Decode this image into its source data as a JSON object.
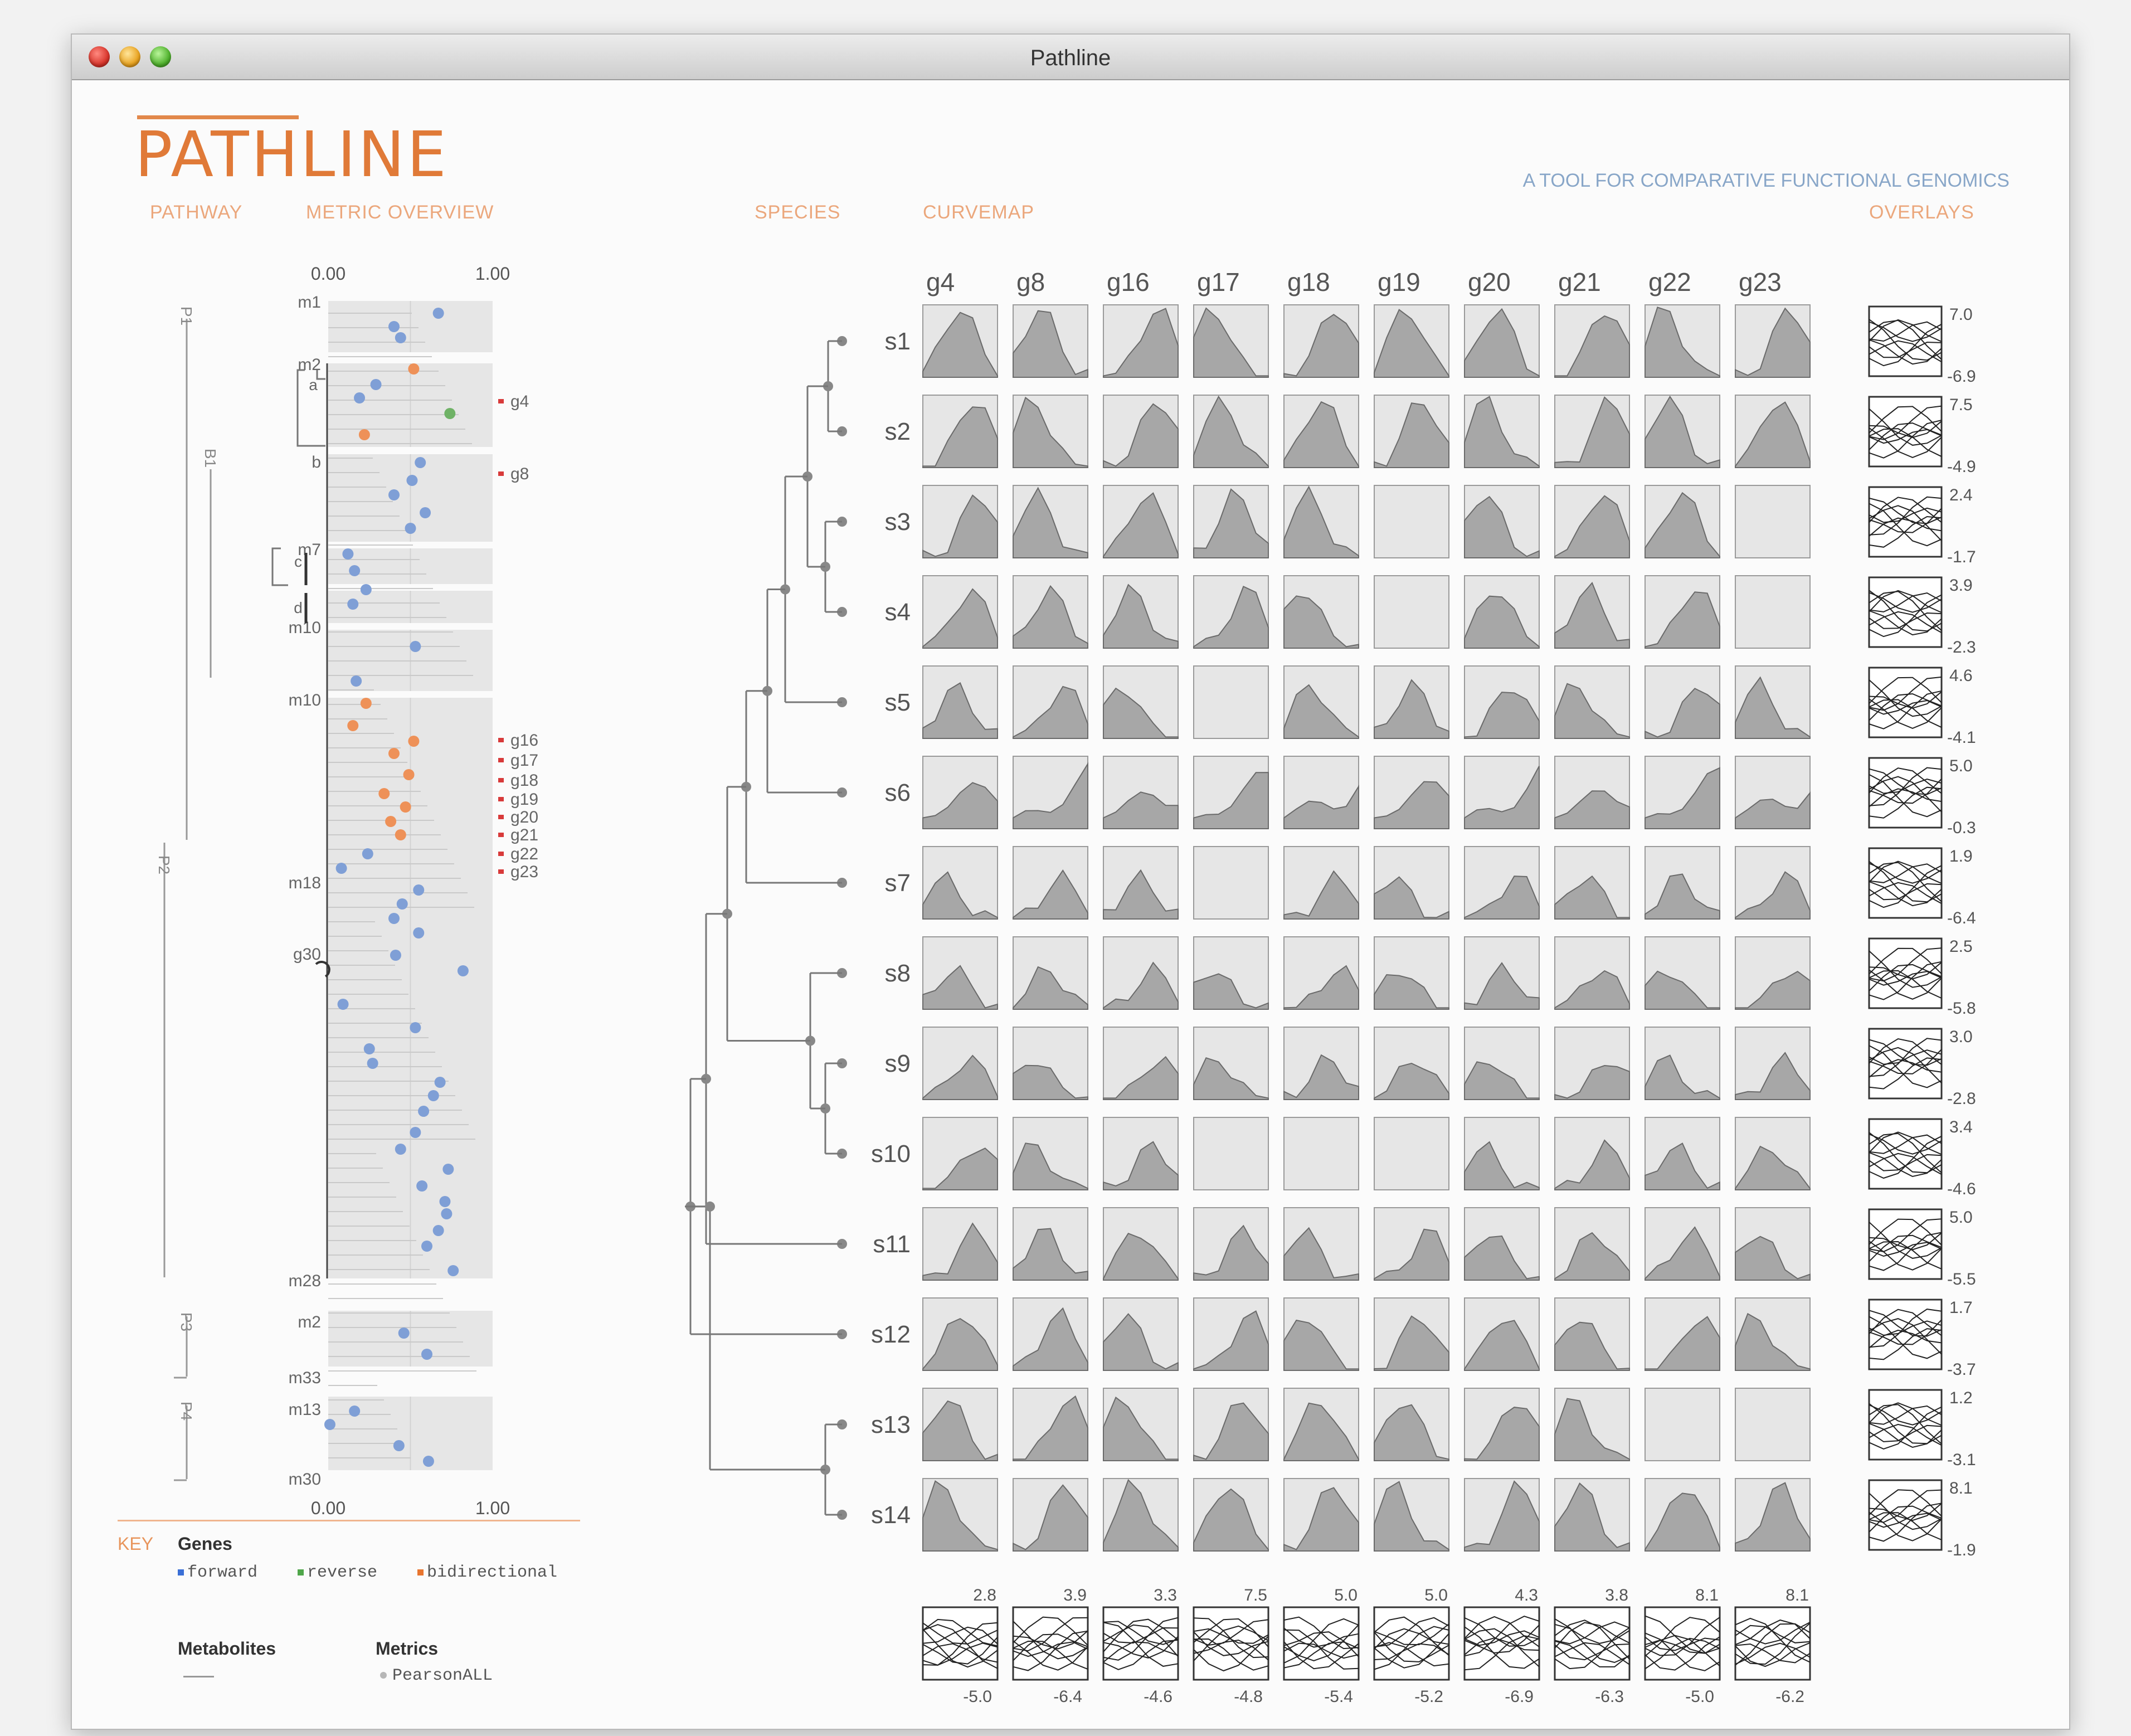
{
  "window": {
    "title": "Pathline"
  },
  "app": {
    "name": "PATHLINE",
    "tagline": "A TOOL FOR COMPARATIVE FUNCTIONAL GENOMICS"
  },
  "sections": {
    "pathway": "PATHWAY",
    "metric": "METRIC OVERVIEW",
    "species": "SPECIES",
    "curvemap": "CURVEMAP",
    "overlays": "OVERLAYS"
  },
  "colors": {
    "accent": "#e07a38",
    "forward": "#7f9fd6",
    "reverse": "#6fb266",
    "bidirectional": "#ee9158",
    "curve_fill": "#a7a7a7",
    "cell_bg": "#e6e6e6"
  },
  "metric": {
    "axis_top": [
      "0.00",
      "1.00"
    ],
    "axis_bottom": [
      "0.00",
      "1.00"
    ],
    "pathways": [
      {
        "id": "P1",
        "sub": "B1"
      },
      {
        "id": "P2"
      },
      {
        "id": "P3"
      },
      {
        "id": "P4"
      }
    ],
    "metabolite_labels": [
      "m1",
      "m2",
      "b",
      "m7",
      "m10",
      "m10",
      "m18",
      "g30",
      "m28",
      "m2",
      "m33",
      "m13",
      "m30"
    ],
    "small_labels": [
      "a",
      "c",
      "d"
    ],
    "gene_labels": [
      "g4",
      "g8",
      "g16",
      "g17",
      "g18",
      "g19",
      "g20",
      "g21",
      "g22",
      "g23"
    ],
    "points": [
      [
        0.67,
        "f"
      ],
      [
        0.4,
        "f"
      ],
      [
        0.44,
        "f"
      ],
      [
        0.52,
        "b"
      ],
      [
        0.29,
        "f"
      ],
      [
        0.19,
        "f"
      ],
      [
        0.74,
        "r"
      ],
      [
        0.22,
        "b"
      ],
      [
        0.56,
        "f"
      ],
      [
        0.51,
        "f"
      ],
      [
        0.4,
        "f"
      ],
      [
        0.59,
        "f"
      ],
      [
        0.5,
        "f"
      ],
      [
        0.12,
        "f"
      ],
      [
        0.16,
        "f"
      ],
      [
        0.23,
        "f"
      ],
      [
        0.15,
        "f"
      ],
      [
        0.53,
        "f"
      ],
      [
        0.17,
        "f"
      ],
      [
        0.23,
        "b"
      ],
      [
        0.15,
        "b"
      ],
      [
        0.52,
        "b"
      ],
      [
        0.4,
        "b"
      ],
      [
        0.49,
        "b"
      ],
      [
        0.34,
        "b"
      ],
      [
        0.47,
        "b"
      ],
      [
        0.38,
        "b"
      ],
      [
        0.44,
        "b"
      ],
      [
        0.24,
        "f"
      ],
      [
        0.08,
        "f"
      ],
      [
        0.55,
        "f"
      ],
      [
        0.45,
        "f"
      ],
      [
        0.4,
        "f"
      ],
      [
        0.55,
        "f"
      ],
      [
        0.41,
        "f"
      ],
      [
        0.82,
        "f"
      ],
      [
        0.09,
        "f"
      ],
      [
        0.53,
        "f"
      ],
      [
        0.25,
        "f"
      ],
      [
        0.27,
        "f"
      ],
      [
        0.68,
        "f"
      ],
      [
        0.64,
        "f"
      ],
      [
        0.58,
        "f"
      ],
      [
        0.53,
        "f"
      ],
      [
        0.44,
        "f"
      ],
      [
        0.73,
        "f"
      ],
      [
        0.57,
        "f"
      ],
      [
        0.71,
        "f"
      ],
      [
        0.72,
        "f"
      ],
      [
        0.67,
        "f"
      ],
      [
        0.6,
        "f"
      ],
      [
        0.76,
        "f"
      ],
      [
        0.46,
        "f"
      ],
      [
        0.6,
        "f"
      ],
      [
        0.01,
        "f"
      ],
      [
        0.16,
        "f"
      ],
      [
        0.43,
        "f"
      ],
      [
        0.61,
        "f"
      ]
    ]
  },
  "species": [
    "s1",
    "s2",
    "s3",
    "s4",
    "s5",
    "s6",
    "s7",
    "s8",
    "s9",
    "s10",
    "s11",
    "s12",
    "s13",
    "s14"
  ],
  "genes": [
    "g4",
    "g8",
    "g16",
    "g17",
    "g18",
    "g19",
    "g20",
    "g21",
    "g22",
    "g23"
  ],
  "overlay_ranges": [
    [
      "7.0",
      "-6.9"
    ],
    [
      "7.5",
      "-4.9"
    ],
    [
      "2.4",
      "-1.7"
    ],
    [
      "3.9",
      "-2.3"
    ],
    [
      "4.6",
      "-4.1"
    ],
    [
      "5.0",
      "-0.3"
    ],
    [
      "1.9",
      "-6.4"
    ],
    [
      "2.5",
      "-5.8"
    ],
    [
      "3.0",
      "-2.8"
    ],
    [
      "3.4",
      "-4.6"
    ],
    [
      "5.0",
      "-5.5"
    ],
    [
      "1.7",
      "-3.7"
    ],
    [
      "1.2",
      "-3.1"
    ],
    [
      "8.1",
      "-1.9"
    ]
  ],
  "gene_overlay_ranges": [
    [
      "2.8",
      "-5.0"
    ],
    [
      "3.9",
      "-6.4"
    ],
    [
      "3.3",
      "-4.6"
    ],
    [
      "7.5",
      "-4.8"
    ],
    [
      "5.0",
      "-5.4"
    ],
    [
      "5.0",
      "-5.2"
    ],
    [
      "4.3",
      "-6.9"
    ],
    [
      "3.8",
      "-6.3"
    ],
    [
      "8.1",
      "-5.0"
    ],
    [
      "8.1",
      "-6.2"
    ]
  ],
  "key": {
    "label": "KEY",
    "genes": "Genes",
    "forward": "forward",
    "reverse": "reverse",
    "bidirectional": "bidirectional",
    "metabolites": "Metabolites",
    "metrics": "Metrics",
    "pearson": "PearsonALL"
  }
}
